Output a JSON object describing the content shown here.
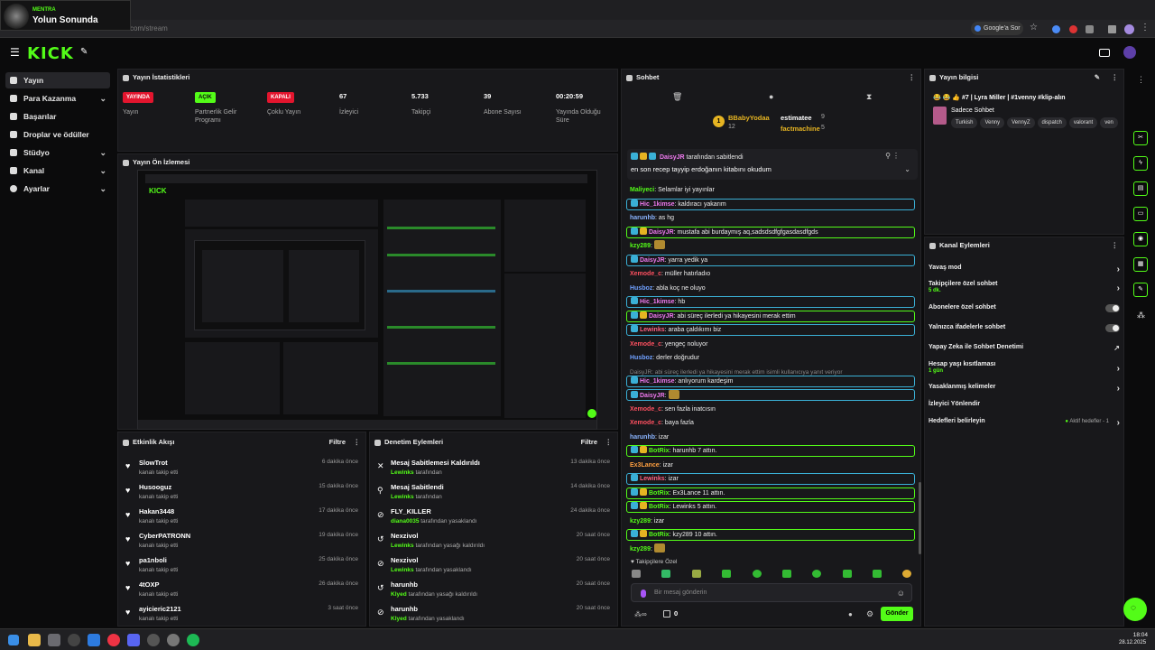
{
  "overlay": {
    "label": "MENTRA",
    "title": "Yolun Sonunda"
  },
  "browser": {
    "url": "dashboard.kick.com/stream",
    "google_button": "Google'a Sor"
  },
  "header": {
    "logo": "KICK"
  },
  "sidebar": {
    "items": [
      {
        "label": "Yayın",
        "active": true
      },
      {
        "label": "Para Kazanma",
        "chevron": true
      },
      {
        "label": "Başarılar"
      },
      {
        "label": "Droplar ve ödüller"
      },
      {
        "label": "Stüdyo",
        "chevron": true
      },
      {
        "label": "Kanal",
        "chevron": true
      },
      {
        "label": "Ayarlar",
        "chevron": true
      }
    ]
  },
  "stats": {
    "title": "Yayın İstatistikleri",
    "items": [
      {
        "badge": "YAYINDA",
        "badge_color": "red",
        "label": "Yayın"
      },
      {
        "badge": "AÇIK",
        "badge_color": "green",
        "label": "Partnerlik Gelir Programı"
      },
      {
        "badge": "KAPALI",
        "badge_color": "red",
        "label": "Çoklu Yayın"
      },
      {
        "value": "67",
        "label": "İzleyici"
      },
      {
        "value": "5.733",
        "label": "Takipçi"
      },
      {
        "value": "39",
        "label": "Abone Sayısı"
      },
      {
        "value": "00:20:59",
        "label": "Yayında Olduğu Süre"
      }
    ]
  },
  "preview": {
    "title": "Yayın Ön İzlemesi"
  },
  "activity": {
    "title": "Etkinlik Akışı",
    "filter": "Filtre",
    "items": [
      {
        "name": "SlowTrot",
        "sub": "kanalı takip etti",
        "time": "6 dakika önce"
      },
      {
        "name": "Husooguz",
        "sub": "kanalı takip etti",
        "time": "15 dakika önce"
      },
      {
        "name": "Hakan3448",
        "sub": "kanalı takip etti",
        "time": "17 dakika önce"
      },
      {
        "name": "CyberPATRONN",
        "sub": "kanalı takip etti",
        "time": "19 dakika önce"
      },
      {
        "name": "pa1nboli",
        "sub": "kanalı takip etti",
        "time": "25 dakika önce"
      },
      {
        "name": "4tOXP",
        "sub": "kanalı takip etti",
        "time": "26 dakika önce"
      },
      {
        "name": "ayicieric2121",
        "sub": "kanalı takip etti",
        "time": "3 saat önce"
      }
    ]
  },
  "moderation": {
    "title": "Denetim Eylemleri",
    "filter": "Filtre",
    "items": [
      {
        "name": "Mesaj Sabitlemesi Kaldırıldı",
        "actor": "Lewinks",
        "action": "tarafından",
        "time": "13 dakika önce",
        "icon": "unpin-icon"
      },
      {
        "name": "Mesaj Sabitlendi",
        "actor": "Lewinks",
        "action": "tarafından",
        "time": "14 dakika önce",
        "icon": "pin-icon"
      },
      {
        "name": "FLY_KILLER",
        "actor": "diana0035",
        "action": "tarafından yasaklandı",
        "time": "24 dakika önce",
        "icon": "ban-icon"
      },
      {
        "name": "Nexzivol",
        "actor": "Lewinks",
        "action": "tarafından yasağı kaldırıldı",
        "time": "20 saat önce",
        "icon": "unban-icon"
      },
      {
        "name": "Nexzivol",
        "actor": "Lewinks",
        "action": "tarafından yasaklandı",
        "time": "20 saat önce",
        "icon": "ban-icon"
      },
      {
        "name": "harunhb",
        "actor": "Klyed",
        "action": "tarafından yasağı kaldırıldı",
        "time": "20 saat önce",
        "icon": "unban-icon"
      },
      {
        "name": "harunhb",
        "actor": "Klyed",
        "action": "tarafından yasaklandı",
        "time": "20 saat önce",
        "icon": "ban-icon"
      }
    ]
  },
  "chat": {
    "title": "Sohbet",
    "top_gifters": [
      {
        "name": "BBabyYodaa",
        "count": "12"
      },
      {
        "name": "estimatee",
        "count": "9"
      },
      {
        "name": "factmachine",
        "count": "5"
      }
    ],
    "pinned": {
      "by_user": "DaisyJR",
      "by_text": "tarafından sabitlendi",
      "text": "en son recep tayyip erdoğanın kitabını okudum"
    },
    "messages": [
      {
        "user": "Maliyeci",
        "color": "#53fc18",
        "text": "Selamlar iyi yayınlar",
        "style": ""
      },
      {
        "user": "Hic_1kimse",
        "color": "#f07af0",
        "text": "kaldıracı yakarım",
        "style": "hlb"
      },
      {
        "user": "harunhb",
        "color": "#8ab4ff",
        "text": "as hg",
        "style": ""
      },
      {
        "user": "DaisyJR",
        "color": "#f07af0",
        "text": "mustafa abi burdaymış aq,sadsdsdfgfgasdasdfgds",
        "style": "hl"
      },
      {
        "user": "kzy289",
        "color": "#53fc18",
        "text": "",
        "style": ""
      },
      {
        "user": "DaisyJR",
        "color": "#f07af0",
        "text": "yarra yedik ya",
        "style": "hlb"
      },
      {
        "user": "Xemode_c",
        "color": "#ff5060",
        "text": "müller hatırladıo",
        "style": ""
      },
      {
        "user": "Husboz",
        "color": "#6fa0ff",
        "text": "abla koç ne oluyo",
        "style": ""
      },
      {
        "user": "Hic_1kimse",
        "color": "#f07af0",
        "text": "hb",
        "style": "hlb"
      },
      {
        "user": "DaisyJR",
        "color": "#f07af0",
        "text": "abi süreç ilerledi ya hikayesini merak ettim",
        "style": "hl"
      },
      {
        "user": "Lewinks",
        "color": "#ff6080",
        "text": "araba çaldıkımı biz",
        "style": "hlb"
      },
      {
        "user": "Xemode_c",
        "color": "#ff5060",
        "text": "yengeç noluyor",
        "style": ""
      },
      {
        "user": "Husboz",
        "color": "#6fa0ff",
        "text": "derler doğrudur",
        "style": ""
      },
      {
        "user": "Hic_1kimse",
        "color": "#f07af0",
        "text": "anlıyorum kardeşim",
        "style": "hlb",
        "reply": "DaisyJR: abi süreç ilerledi ya hikayesini merak ettim isimli kullanıcıya yanıt veriyor"
      },
      {
        "user": "DaisyJR",
        "color": "#f07af0",
        "text": "",
        "style": "hlb"
      },
      {
        "user": "Xemode_c",
        "color": "#ff5060",
        "text": "sen fazla inatcısın",
        "style": ""
      },
      {
        "user": "Xemode_c",
        "color": "#ff5060",
        "text": "baya fazla",
        "style": ""
      },
      {
        "user": "harunhb",
        "color": "#8ab4ff",
        "text": "izar",
        "style": ""
      },
      {
        "user": "BotRix",
        "color": "#53fc18",
        "text": "harunhb 7 attın.",
        "style": "hl"
      },
      {
        "user": "Ex3Lance",
        "color": "#ffa040",
        "text": "izar",
        "style": ""
      },
      {
        "user": "Lewinks",
        "color": "#ff6080",
        "text": "izar",
        "style": "hlb"
      },
      {
        "user": "BotRix",
        "color": "#53fc18",
        "text": "Ex3Lance 11 attın.",
        "style": "hl"
      },
      {
        "user": "BotRix",
        "color": "#53fc18",
        "text": "Lewinks 5 attın.",
        "style": "hl"
      },
      {
        "user": "kzy289",
        "color": "#53fc18",
        "text": "izar",
        "style": ""
      },
      {
        "user": "BotRix",
        "color": "#53fc18",
        "text": "kzy289 10 attın.",
        "style": "hl"
      },
      {
        "user": "kzy289",
        "color": "#53fc18",
        "text": "",
        "style": ""
      }
    ],
    "followers_only_label": "Takipçilere Özel",
    "input_placeholder": "Bir mesaj gönderin",
    "viewer_count": "0",
    "send_label": "Gönder"
  },
  "stream_info": {
    "title": "Yayın bilgisi",
    "stream_title": "😂 😂 👍 #7 | Lyra Miller | #1venny #klip-alın",
    "category": "Sadece Sohbet",
    "tags": [
      "Turkish",
      "Venny",
      "VennyZ",
      "dispatch",
      "valorant",
      "ven"
    ]
  },
  "channel_actions": {
    "title": "Kanal Eylemleri",
    "items": [
      {
        "label": "Yavaş mod",
        "type": "arrow"
      },
      {
        "label": "Takipçilere özel sohbet",
        "sub": "5 dk.",
        "type": "arrow"
      },
      {
        "label": "Abonelere özel sohbet",
        "type": "toggle"
      },
      {
        "label": "Yalnızca ifadelerle sohbet",
        "type": "toggle"
      },
      {
        "label": "Yapay Zeka ile Sohbet Denetimi",
        "type": "external"
      },
      {
        "label": "Hesap yaşı kısıtlaması",
        "sub": "1 gün",
        "type": "arrow"
      },
      {
        "label": "Yasaklanmış kelimeler",
        "type": "arrow"
      },
      {
        "label": "İzleyici Yönlendir",
        "type": "none"
      },
      {
        "label": "Hedefleri belirleyin",
        "extra": "Aktif hedefler - 1",
        "type": "arrow"
      }
    ]
  },
  "taskbar": {
    "time": "18:04",
    "date": "28.12.2025"
  },
  "colors": {
    "accent": "#53fc18",
    "live_red": "#e3152e",
    "panel_bg": "#18181b",
    "page_bg": "#0b0b0c"
  }
}
